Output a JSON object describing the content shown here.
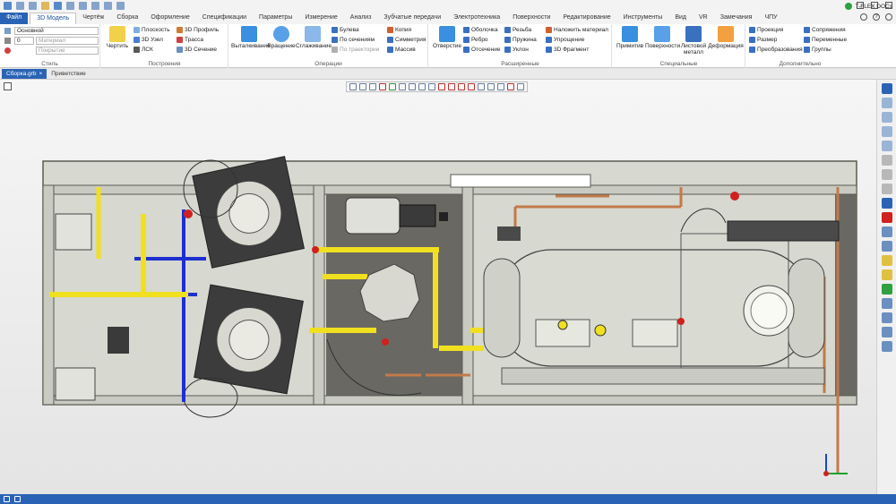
{
  "app": {
    "name": "T-FLEX DOCs"
  },
  "menu_tabs": [
    {
      "label": "Файл"
    },
    {
      "label": "3D Модель"
    },
    {
      "label": "Чертёж"
    },
    {
      "label": "Сборка"
    },
    {
      "label": "Оформление"
    },
    {
      "label": "Спецификации"
    },
    {
      "label": "Параметры"
    },
    {
      "label": "Измерение"
    },
    {
      "label": "Анализ"
    },
    {
      "label": "Зубчатые передачи"
    },
    {
      "label": "Электротехника"
    },
    {
      "label": "Поверхности"
    },
    {
      "label": "Редактирование"
    },
    {
      "label": "Инструменты"
    },
    {
      "label": "Вид"
    },
    {
      "label": "VR"
    },
    {
      "label": "Замечания"
    },
    {
      "label": "ЧПУ"
    }
  ],
  "style_group": {
    "label": "Стиль",
    "layer_value": "Основной",
    "level_value": "0",
    "material_placeholder": "Материал",
    "coating_placeholder": "Покрытие"
  },
  "construction_group": {
    "label": "Построения",
    "draw": "Чертить",
    "plane": "Плоскость",
    "node3d": "3D Узел",
    "lsk": "ЛСК",
    "profile3d": "3D Профиль",
    "path": "Трасса",
    "section3d": "3D Сечение"
  },
  "operations_group": {
    "label": "Операции",
    "extrude": "Выталкивание",
    "revolve": "Вращение",
    "loft": "Сглаживание",
    "boolean": "Булева",
    "by_sections": "По сечениям",
    "by_path": "По траектории",
    "copy": "Копия",
    "symmetry": "Симметрия",
    "array": "Массив"
  },
  "extended_group": {
    "label": "Расширенные",
    "hole": "Отверстие",
    "shell": "Оболочка",
    "rib": "Ребро",
    "cut": "Отсечение",
    "thread": "Резьба",
    "spring": "Пружина",
    "draft": "Уклон",
    "apply_material": "Наложить материал",
    "simplify": "Упрощение",
    "fragment3d": "3D Фрагмент"
  },
  "special_group": {
    "label": "Специальные",
    "primitive": "Примитив",
    "surfaces": "Поверхности",
    "sheet_metal": "Листовой металл",
    "deformation": "Деформация"
  },
  "extra_group": {
    "label": "Дополнительно",
    "projection": "Проекция",
    "dimension": "Размер",
    "transforms": "Преобразования",
    "mates": "Сопряжения",
    "variables": "Переменные",
    "groups": "Группы"
  },
  "document_tabs": [
    {
      "label": "Сборка.grb"
    },
    {
      "label": "Приветствие"
    }
  ],
  "colors": {
    "accent": "#2a63b5",
    "frame": "#c9cbc2",
    "pipe_yellow": "#f0e020",
    "pipe_blue": "#1e2fd0",
    "pipe_copper": "#c27a4a",
    "tank": "#d9dbd2",
    "floor_dark": "#6a6862",
    "cooler_grid": "#3c3c3c"
  }
}
